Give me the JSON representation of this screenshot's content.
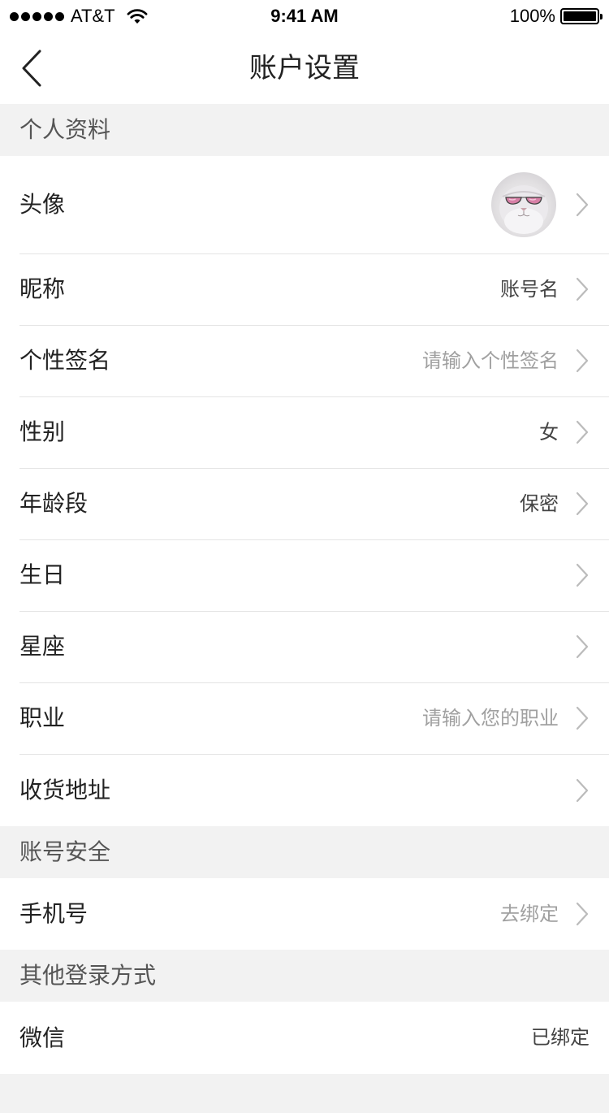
{
  "status_bar": {
    "carrier": "AT&T",
    "time": "9:41 AM",
    "battery": "100%",
    "battery_level": 1.0
  },
  "nav": {
    "title": "账户设置",
    "back_icon": "chevron-left-icon"
  },
  "sections": {
    "profile": "个人资料",
    "security": "账号安全",
    "other_login": "其他登录方式"
  },
  "profile_rows": {
    "avatar": {
      "label": "头像"
    },
    "nickname": {
      "label": "昵称",
      "value": "账号名"
    },
    "signature": {
      "label": "个性签名",
      "placeholder": "请输入个性签名"
    },
    "gender": {
      "label": "性别",
      "value": "女"
    },
    "age_group": {
      "label": "年龄段",
      "value": "保密"
    },
    "birthday": {
      "label": "生日"
    },
    "constellation": {
      "label": "星座"
    },
    "occupation": {
      "label": "职业",
      "placeholder": "请输入您的职业"
    },
    "address": {
      "label": "收货地址"
    }
  },
  "security_rows": {
    "phone": {
      "label": "手机号",
      "value": "去绑定"
    }
  },
  "other_login_rows": {
    "wechat": {
      "label": "微信",
      "value": "已绑定"
    }
  },
  "colors": {
    "background": "#f2f2f2",
    "row": "#ffffff",
    "text": "#222222",
    "muted": "#a0a0a0",
    "divider": "#e4e4e4"
  }
}
